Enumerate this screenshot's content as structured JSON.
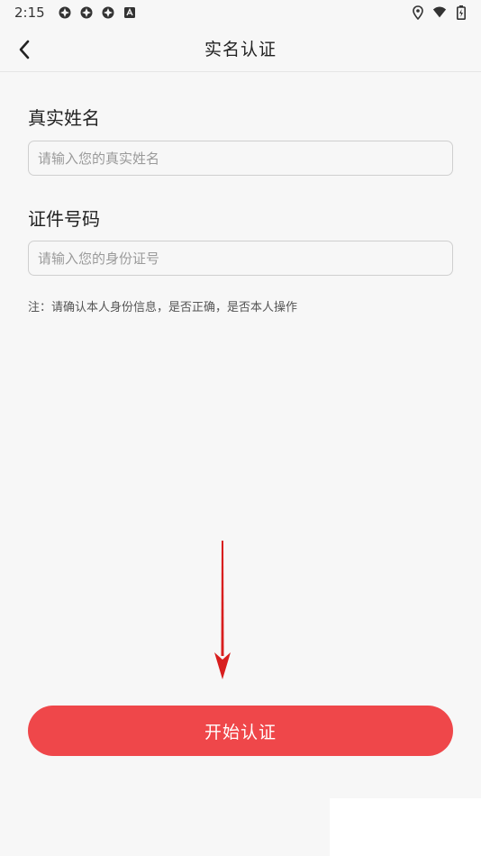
{
  "status_bar": {
    "time": "2:15",
    "notification_icons": [
      "app-notification-icon",
      "app-notification-icon",
      "app-notification-icon",
      "text-notification-icon"
    ],
    "right_icons": [
      "location-icon",
      "wifi-icon",
      "battery-icon"
    ]
  },
  "header": {
    "title": "实名认证",
    "back_icon": "chevron-left-icon"
  },
  "form": {
    "name_label": "真实姓名",
    "name_placeholder": "请输入您的真实姓名",
    "id_label": "证件号码",
    "id_placeholder": "请输入您的身份证号",
    "note": "注：请确认本人身份信息，是否正确，是否本人操作"
  },
  "annotation": {
    "arrow_icon": "red-down-arrow-icon",
    "arrow_color": "#d81e1e"
  },
  "actions": {
    "start_label": "开始认证"
  },
  "colors": {
    "accent": "#ef474a",
    "background": "#f7f7f7"
  }
}
